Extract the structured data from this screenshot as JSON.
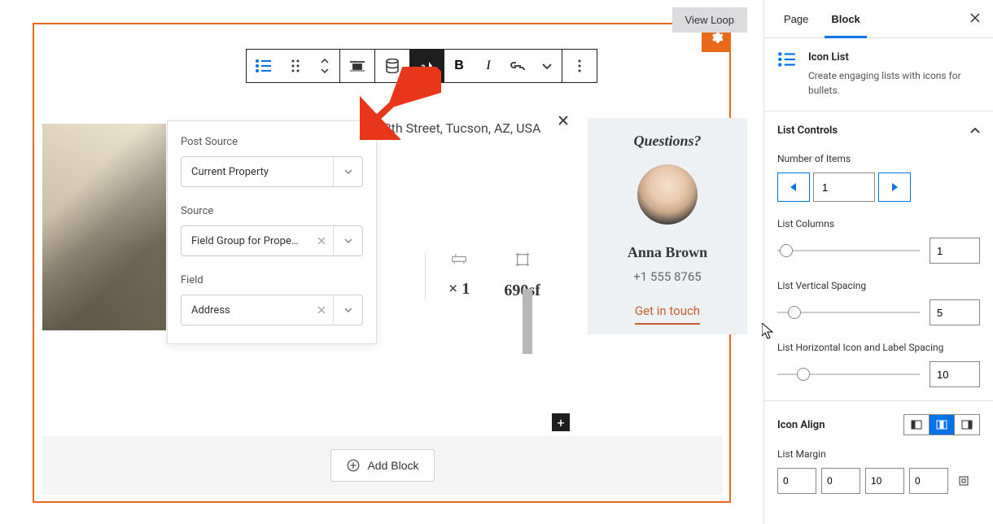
{
  "header": {
    "view_loop": "View Loop"
  },
  "address": "Tucson, East 12th Street, Tucson, AZ, USA",
  "popup": {
    "post_source_label": "Post Source",
    "post_source_value": "Current Property",
    "source_label": "Source",
    "source_value": "Field Group for Propert...",
    "field_label": "Field",
    "field_value": "Address"
  },
  "stats": {
    "stat1": "× 1",
    "stat2": "690sf"
  },
  "agent": {
    "title": "Questions?",
    "name": "Anna Brown",
    "phone": "+1 555 8765",
    "cta": "Get in touch"
  },
  "add_block": "Add Block",
  "sidebar": {
    "tabs": {
      "page": "Page",
      "block": "Block"
    },
    "block_title": "Icon List",
    "block_desc": "Create engaging lists with icons for bullets.",
    "panel_title": "List Controls",
    "num_items_label": "Number of Items",
    "num_items_value": "1",
    "list_columns_label": "List Columns",
    "list_columns_value": "1",
    "vspace_label": "List Vertical Spacing",
    "vspace_value": "5",
    "hspace_label": "List Horizontal Icon and Label Spacing",
    "hspace_value": "10",
    "icon_align_label": "Icon Align",
    "margin_label": "List Margin",
    "margin": [
      "0",
      "0",
      "10",
      "0"
    ]
  }
}
